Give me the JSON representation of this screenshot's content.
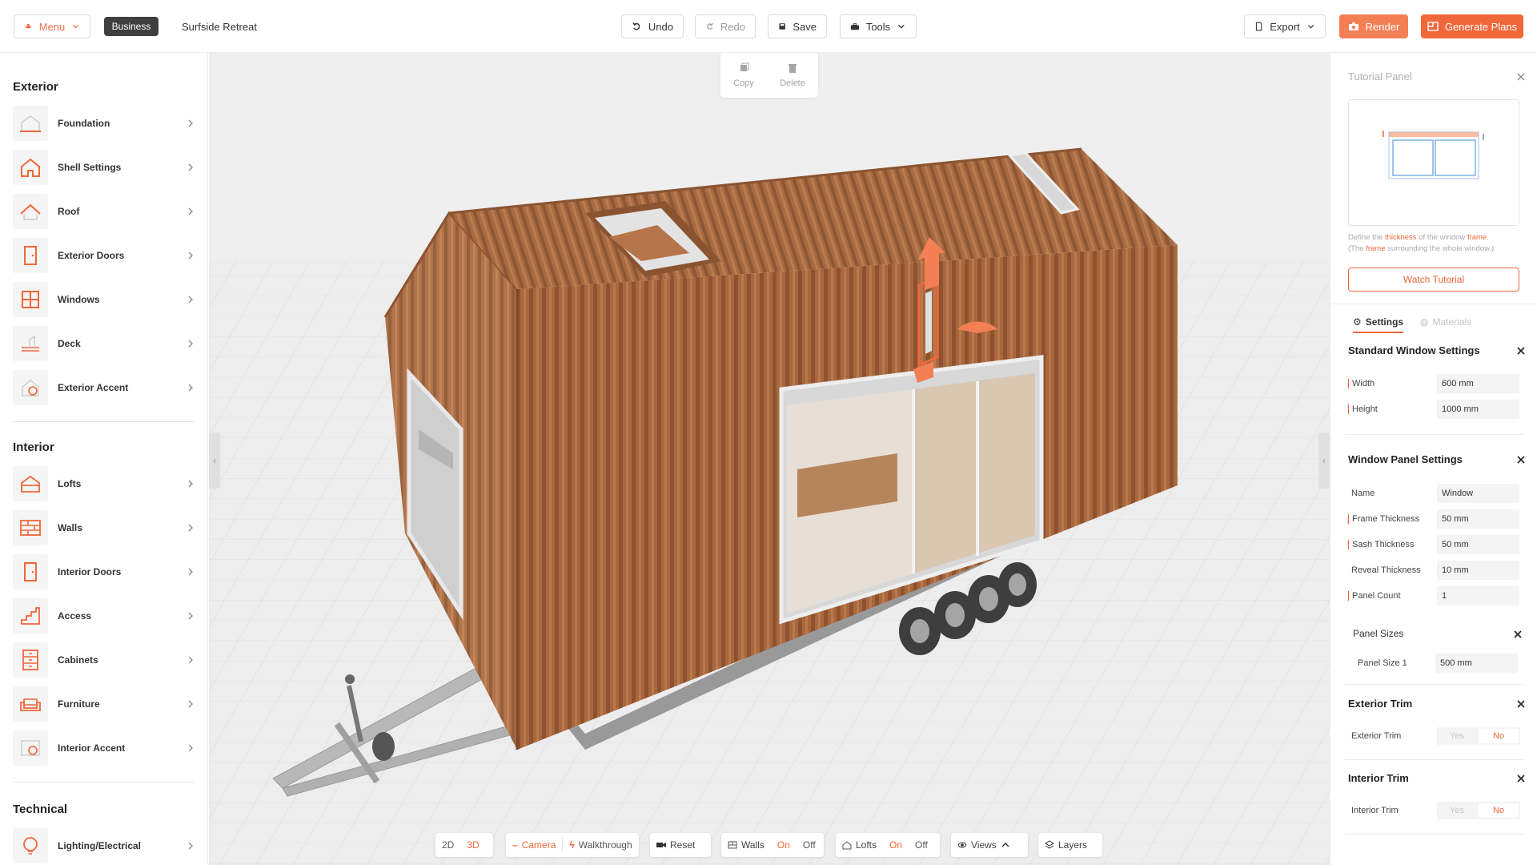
{
  "topbar": {
    "menu_label": "Menu",
    "business_label": "Business",
    "project_name": "Surfside Retreat",
    "undo_label": "Undo",
    "redo_label": "Redo",
    "save_label": "Save",
    "tools_label": "Tools",
    "export_label": "Export",
    "render_label": "Render",
    "generate_plans_label": "Generate Plans"
  },
  "sidebar": {
    "exterior_title": "Exterior",
    "exterior_items": [
      {
        "label": "Foundation",
        "icon": "foundation-icon"
      },
      {
        "label": "Shell Settings",
        "icon": "house-icon"
      },
      {
        "label": "Roof",
        "icon": "roof-icon"
      },
      {
        "label": "Exterior Doors",
        "icon": "door-icon"
      },
      {
        "label": "Windows",
        "icon": "window-icon"
      },
      {
        "label": "Deck",
        "icon": "deck-icon"
      },
      {
        "label": "Exterior Accent",
        "icon": "palette-icon"
      }
    ],
    "interior_title": "Interior",
    "interior_items": [
      {
        "label": "Lofts",
        "icon": "loft-icon"
      },
      {
        "label": "Walls",
        "icon": "brick-wall-icon"
      },
      {
        "label": "Interior Doors",
        "icon": "door-icon"
      },
      {
        "label": "Access",
        "icon": "stairs-icon"
      },
      {
        "label": "Cabinets",
        "icon": "cabinet-icon"
      },
      {
        "label": "Furniture",
        "icon": "sofa-icon"
      },
      {
        "label": "Interior Accent",
        "icon": "palette-icon"
      }
    ],
    "technical_title": "Technical",
    "technical_items": [
      {
        "label": "Lighting/Electrical",
        "icon": "bulb-icon"
      }
    ]
  },
  "viewport": {
    "copy_label": "Copy",
    "delete_label": "Delete"
  },
  "bottom_toolbar": {
    "mode_2d": "2D",
    "mode_3d": "3D",
    "camera_label": "Camera",
    "walkthrough_label": "Walkthrough",
    "reset_label": "Reset",
    "walls_label": "Walls",
    "walls_on": "On",
    "walls_off": "Off",
    "lofts_label": "Lofts",
    "lofts_on": "On",
    "lofts_off": "Off",
    "views_label": "Views",
    "layers_label": "Layers"
  },
  "right_panel": {
    "tutorial_title": "Tutorial Panel",
    "tutorial_desc": {
      "p1": "Define the ",
      "k1": "thickness",
      "p2": " of the window ",
      "k2": "frame",
      "p3": ".",
      "p4": "(The ",
      "k3": "frame",
      "p5": " surrounding the whole window.)"
    },
    "watch_tutorial_label": "Watch Tutorial",
    "tab_settings": "Settings",
    "tab_materials": "Materials",
    "standard_window": {
      "title": "Standard Window Settings",
      "width_label": "Width",
      "width_value": "600 mm",
      "height_label": "Height",
      "height_value": "1000 mm"
    },
    "window_panel": {
      "title": "Window Panel Settings",
      "name_label": "Name",
      "name_value": "Window",
      "frame_label": "Frame Thickness",
      "frame_value": "50 mm",
      "sash_label": "Sash Thickness",
      "sash_value": "50 mm",
      "reveal_label": "Reveal Thickness",
      "reveal_value": "10 mm",
      "count_label": "Panel Count",
      "count_value": "1",
      "panel_sizes_title": "Panel Sizes",
      "panel_size1_label": "Panel Size 1",
      "panel_size1_value": "500 mm"
    },
    "exterior_trim": {
      "title": "Exterior Trim",
      "label": "Exterior Trim",
      "yes": "Yes",
      "no": "No"
    },
    "interior_trim": {
      "title": "Interior Trim",
      "label": "Interior Trim",
      "yes": "Yes",
      "no": "No"
    }
  },
  "colors": {
    "accent": "#f0673a",
    "wood": "#a8673d",
    "chip_dark": "#3f3f3f"
  }
}
